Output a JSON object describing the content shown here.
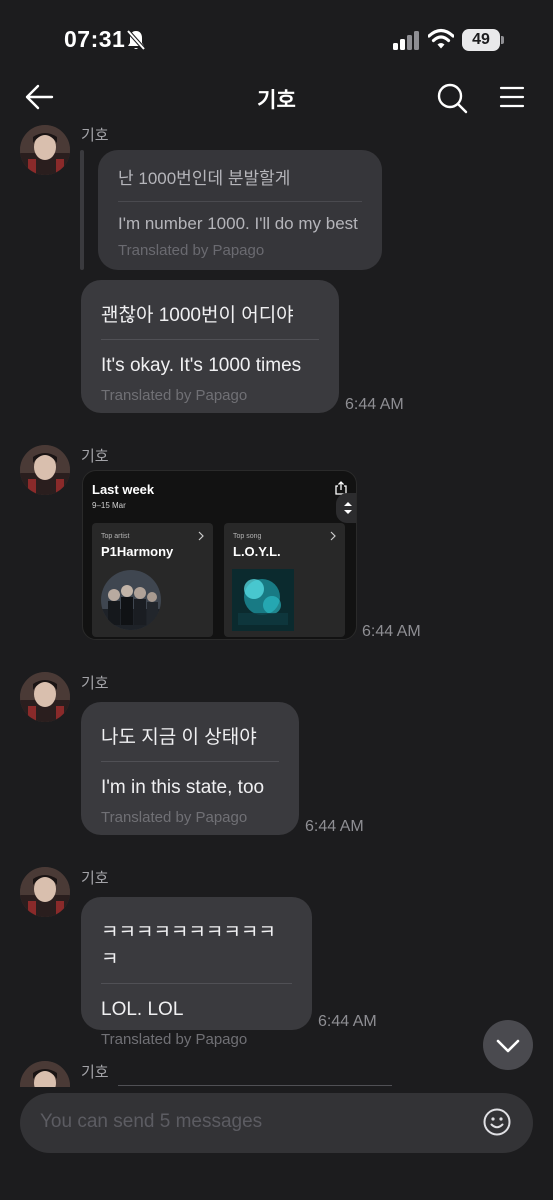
{
  "status": {
    "time": "07:31",
    "battery": "49"
  },
  "header": {
    "title": "기호"
  },
  "messages": [
    {
      "sender": "기호"
    },
    {
      "sender": "기호",
      "timestamp": "6:44 AM"
    },
    {
      "sender": "기호",
      "timestamp": "6:44 AM"
    },
    {
      "sender": "기호",
      "timestamp": "6:44 AM"
    },
    {
      "sender": "기호"
    }
  ],
  "quoted": {
    "original": "난 1000번인데 분발할게",
    "translation": "I'm number 1000. I'll do my best",
    "note": "Translated by Papago"
  },
  "bubble1": {
    "original": "괜찮아 1000번이 어디야",
    "translation": "It's okay. It's 1000 times",
    "note": "Translated by Papago",
    "timestamp": "6:44 AM"
  },
  "music_card": {
    "title": "Last week",
    "date": "9–15 Mar",
    "tiles": [
      {
        "caption": "Top artist",
        "name": "P1Harmony"
      },
      {
        "caption": "Top song",
        "name": "L.O.Y.L."
      }
    ]
  },
  "bubble3": {
    "original": "나도 지금 이 상태야",
    "translation": "I'm in this state, too",
    "note": "Translated by Papago"
  },
  "bubble4": {
    "original": "ㅋㅋㅋㅋㅋㅋㅋㅋㅋㅋㅋ",
    "translation": "LOL. LOL",
    "note": "Translated by Papago"
  },
  "input": {
    "placeholder": "You can send 5 messages"
  },
  "icons": [
    "bell-slash-icon",
    "signal-icon",
    "wifi-icon",
    "back-arrow-icon",
    "search-icon",
    "menu-icon",
    "share-icon",
    "chevron-right-icon",
    "chevron-down-icon",
    "emoji-icon"
  ]
}
